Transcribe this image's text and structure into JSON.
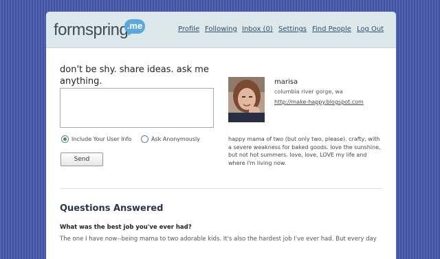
{
  "brand": {
    "logo_text": "formspring",
    "logo_bubble": ".me",
    "color": "#5da8db"
  },
  "nav": {
    "items": [
      {
        "label": "Profile"
      },
      {
        "label": "Following"
      },
      {
        "label": "Inbox (0)"
      },
      {
        "label": "Settings"
      },
      {
        "label": "Find People"
      },
      {
        "label": "Log Out"
      }
    ]
  },
  "ask": {
    "prompt": "don't be shy. share ideas. ask me anything.",
    "question_value": "",
    "option_include": "Include Your User Info",
    "option_anonymous": "Ask Anonymously",
    "selected_option": "include",
    "send_label": "Send"
  },
  "profile": {
    "name": "marisa",
    "location": "columbia river gorge, wa",
    "website": "http://make-happy.blogspot.com",
    "bio": "happy mama of two (but only two, please). crafty, with a severe weakness for baked goods. love the sunshine, but not hot summers. love, love, LOVE my life and where i'm living now."
  },
  "answered": {
    "heading": "Questions Answered",
    "question": "What was the best job you've ever had?",
    "answer": "The one I have now--being mama to two adorable kids. It's also the hardest job I've ever had. But every day"
  },
  "colors": {
    "background": "#4a5ca8",
    "header": "#dde8ec",
    "nav_text": "#2f4f6a",
    "radio_selected": "#3b9a4a"
  }
}
